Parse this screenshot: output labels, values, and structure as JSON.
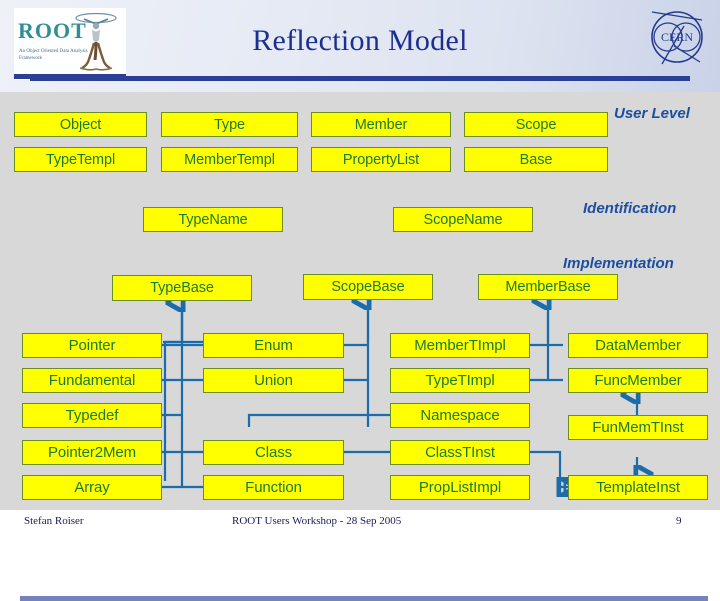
{
  "header": {
    "title": "Reflection Model",
    "root_logo": {
      "wordmark": "ROOT",
      "tagline": "An Object Oriented Data Analysis Framework"
    },
    "cern_logo": {
      "label": "CERN"
    }
  },
  "colors": {
    "box_fill": "#ffff00",
    "box_border": "#6b8f1e",
    "box_text": "#1d7a32",
    "wire": "#1b6ca8",
    "label": "#1d4fa0",
    "title": "#1c2f8f",
    "slide_bg": "#d8d8d8",
    "rule": "#2b3f96",
    "footer_rule": "#7482bd"
  },
  "section_labels": {
    "user_level": "User Level",
    "identification": "Identification",
    "implementation": "Implementation"
  },
  "user_level": {
    "row1": [
      "Object",
      "Type",
      "Member",
      "Scope"
    ],
    "row2": [
      "TypeTempl",
      "MemberTempl",
      "PropertyList",
      "Base"
    ]
  },
  "identification": {
    "boxes": [
      "TypeName",
      "ScopeName"
    ]
  },
  "implementation": {
    "base_boxes": [
      "TypeBase",
      "ScopeBase",
      "MemberBase"
    ],
    "col1": [
      "Pointer",
      "Fundamental",
      "Typedef",
      "Pointer2Mem",
      "Array"
    ],
    "col2": [
      "Enum",
      "Union",
      "Class",
      "Function"
    ],
    "col3": [
      "MemberTImpl",
      "TypeTImpl",
      "Namespace",
      "ClassTInst",
      "PropListImpl"
    ],
    "col4": [
      "DataMember",
      "FuncMember",
      "FunMemTInst",
      "TemplateInst"
    ]
  },
  "footer": {
    "author": "Stefan Roiser",
    "event": "ROOT Users Workshop  -   28 Sep 2005",
    "page": "9"
  }
}
